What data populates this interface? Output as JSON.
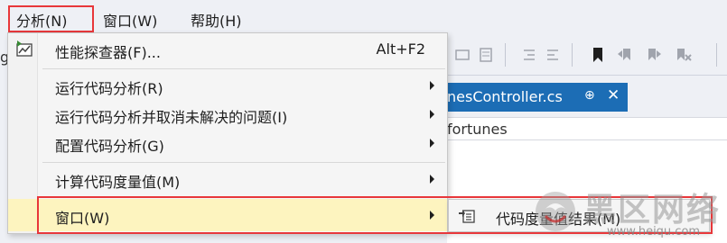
{
  "menubar": {
    "items": [
      {
        "label": "分析(N)"
      },
      {
        "label": "窗口(W)"
      },
      {
        "label": "帮助(H)"
      }
    ]
  },
  "left_edge_text": "g",
  "document_tab": {
    "title": "nesController.cs",
    "pin_glyph": "⊕",
    "close_glyph": "✕"
  },
  "navigation_bar": {
    "text": "fortunes"
  },
  "analyze_menu": {
    "items": [
      {
        "label": "性能探查器(F)...",
        "shortcut": "Alt+F2",
        "icon": "performance-profiler-icon"
      },
      {
        "label": "运行代码分析(R)",
        "submenu": true
      },
      {
        "label": "运行代码分析并取消未解决的问题(I)",
        "submenu": true
      },
      {
        "label": "配置代码分析(G)",
        "submenu": true
      },
      {
        "label": "计算代码度量值(M)",
        "submenu": true
      },
      {
        "label": "窗口(W)",
        "submenu": true,
        "active": true
      }
    ]
  },
  "window_submenu": {
    "items": [
      {
        "label": "代码度量值结果(M)",
        "icon": "code-metrics-results-icon"
      }
    ]
  },
  "watermark": {
    "text": "黑区网络",
    "url": "www.heiqu.com"
  },
  "colors": {
    "highlight_border": "#e8373a",
    "active_item_bg": "#fdf4bf",
    "tab_accent": "#1c6db5",
    "menu_bg": "#f5f5f5",
    "chrome_bg": "#eef0f5"
  }
}
